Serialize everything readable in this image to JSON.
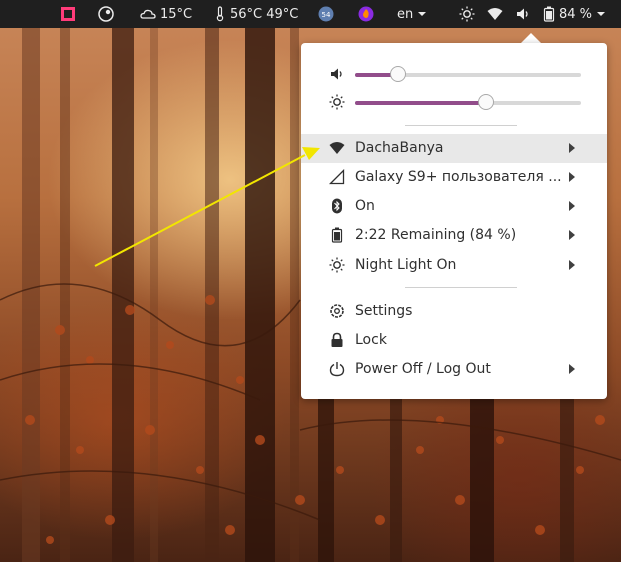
{
  "topbar": {
    "weather_temp": "15°C",
    "sensor_temps": "56°C 49°C",
    "badge_count": "54",
    "language": "en",
    "battery_percent": "84 %"
  },
  "menu": {
    "volume_level": 0.19,
    "brightness_level": 0.58,
    "items": [
      {
        "label": "DachaBanya",
        "icon": "wifi-icon"
      },
      {
        "label": "Galaxy S9+ пользователя ...",
        "icon": "mobile-signal-icon"
      },
      {
        "label": "On",
        "icon": "bluetooth-icon"
      },
      {
        "label": "2:22 Remaining (84 %)",
        "icon": "battery-icon"
      },
      {
        "label": "Night Light On",
        "icon": "night-light-icon"
      },
      {
        "label": "Settings",
        "icon": "settings-icon"
      },
      {
        "label": "Lock",
        "icon": "lock-icon"
      },
      {
        "label": "Power Off / Log Out",
        "icon": "power-icon"
      }
    ]
  },
  "colors": {
    "accent": "#924d8b",
    "panel": "#1f1f1f",
    "annotation_arrow": "#f2e600"
  }
}
